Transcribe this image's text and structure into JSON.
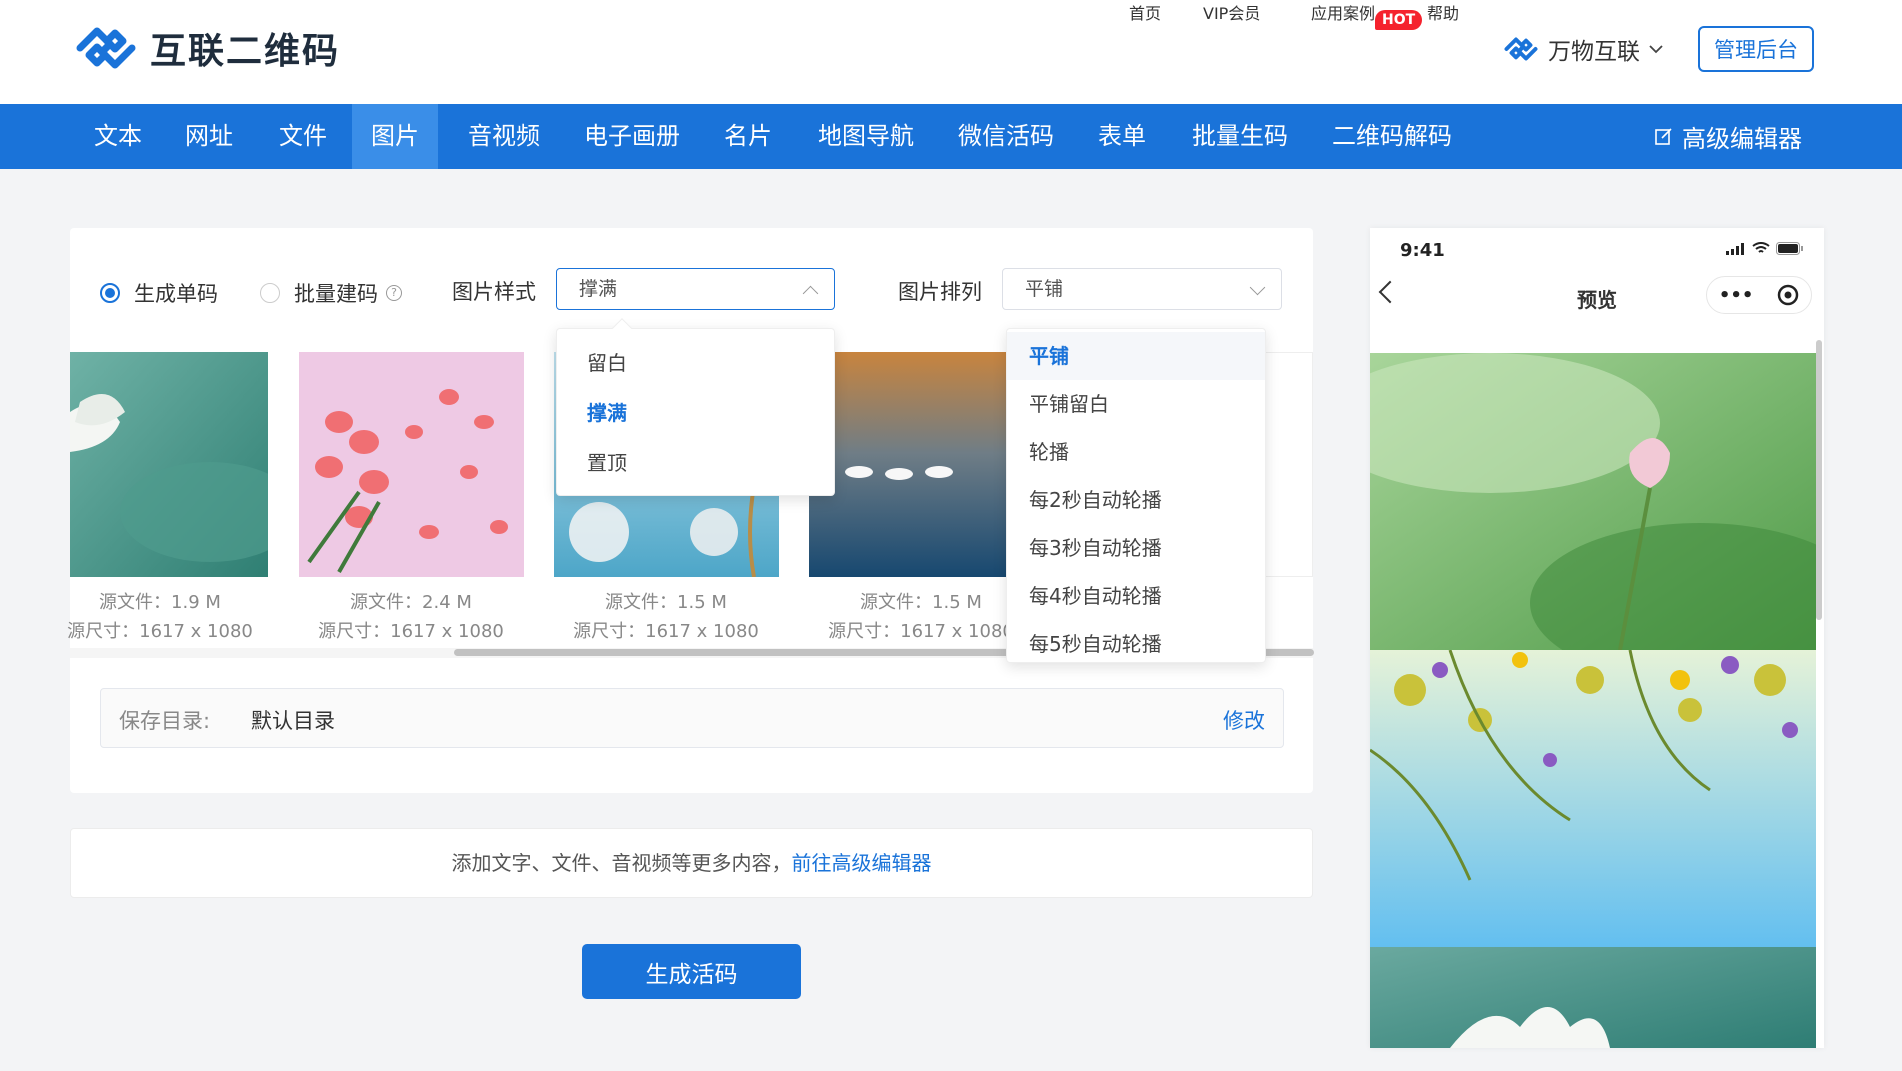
{
  "header": {
    "logo_text": "互联二维码",
    "nav": [
      "首页",
      "VIP会员",
      "应用案例",
      "帮助"
    ],
    "hot_badge": "HOT",
    "brand": "万物互联",
    "admin_button": "管理后台"
  },
  "tabs": [
    "文本",
    "网址",
    "文件",
    "图片",
    "音视频",
    "电子画册",
    "名片",
    "地图导航",
    "微信活码",
    "表单",
    "批量生码",
    "二维码解码"
  ],
  "active_tab": "图片",
  "advanced_editor": "高级编辑器",
  "options": {
    "single": "生成单码",
    "batch": "批量建码",
    "style_label": "图片样式",
    "style_value": "撑满",
    "arrange_label": "图片排列",
    "arrange_value": "平铺"
  },
  "style_options": [
    "留白",
    "撑满",
    "置顶"
  ],
  "arrange_options": [
    "平铺",
    "平铺留白",
    "轮播",
    "每2秒自动轮播",
    "每3秒自动轮播",
    "每4秒自动轮播",
    "每5秒自动轮播"
  ],
  "images": [
    {
      "file": "源文件：1.9 M",
      "size": "源尺寸：1617 x 1080"
    },
    {
      "file": "源文件：2.4 M",
      "size": "源尺寸：1617 x 1080"
    },
    {
      "file": "源文件：1.5 M",
      "size": "源尺寸：1617 x 1080"
    },
    {
      "file": "源文件：1.5 M",
      "size": "源尺寸：1617 x 1080"
    }
  ],
  "save": {
    "label": "保存目录:",
    "value": "默认目录",
    "edit": "修改"
  },
  "tip": {
    "text": "添加文字、文件、音视频等更多内容，",
    "link": "前往高级编辑器"
  },
  "generate_button": "生成活码",
  "phone": {
    "time": "9:41",
    "title": "预览"
  },
  "colors": {
    "accent": "#1a73d9",
    "hot": "#f5222d"
  }
}
